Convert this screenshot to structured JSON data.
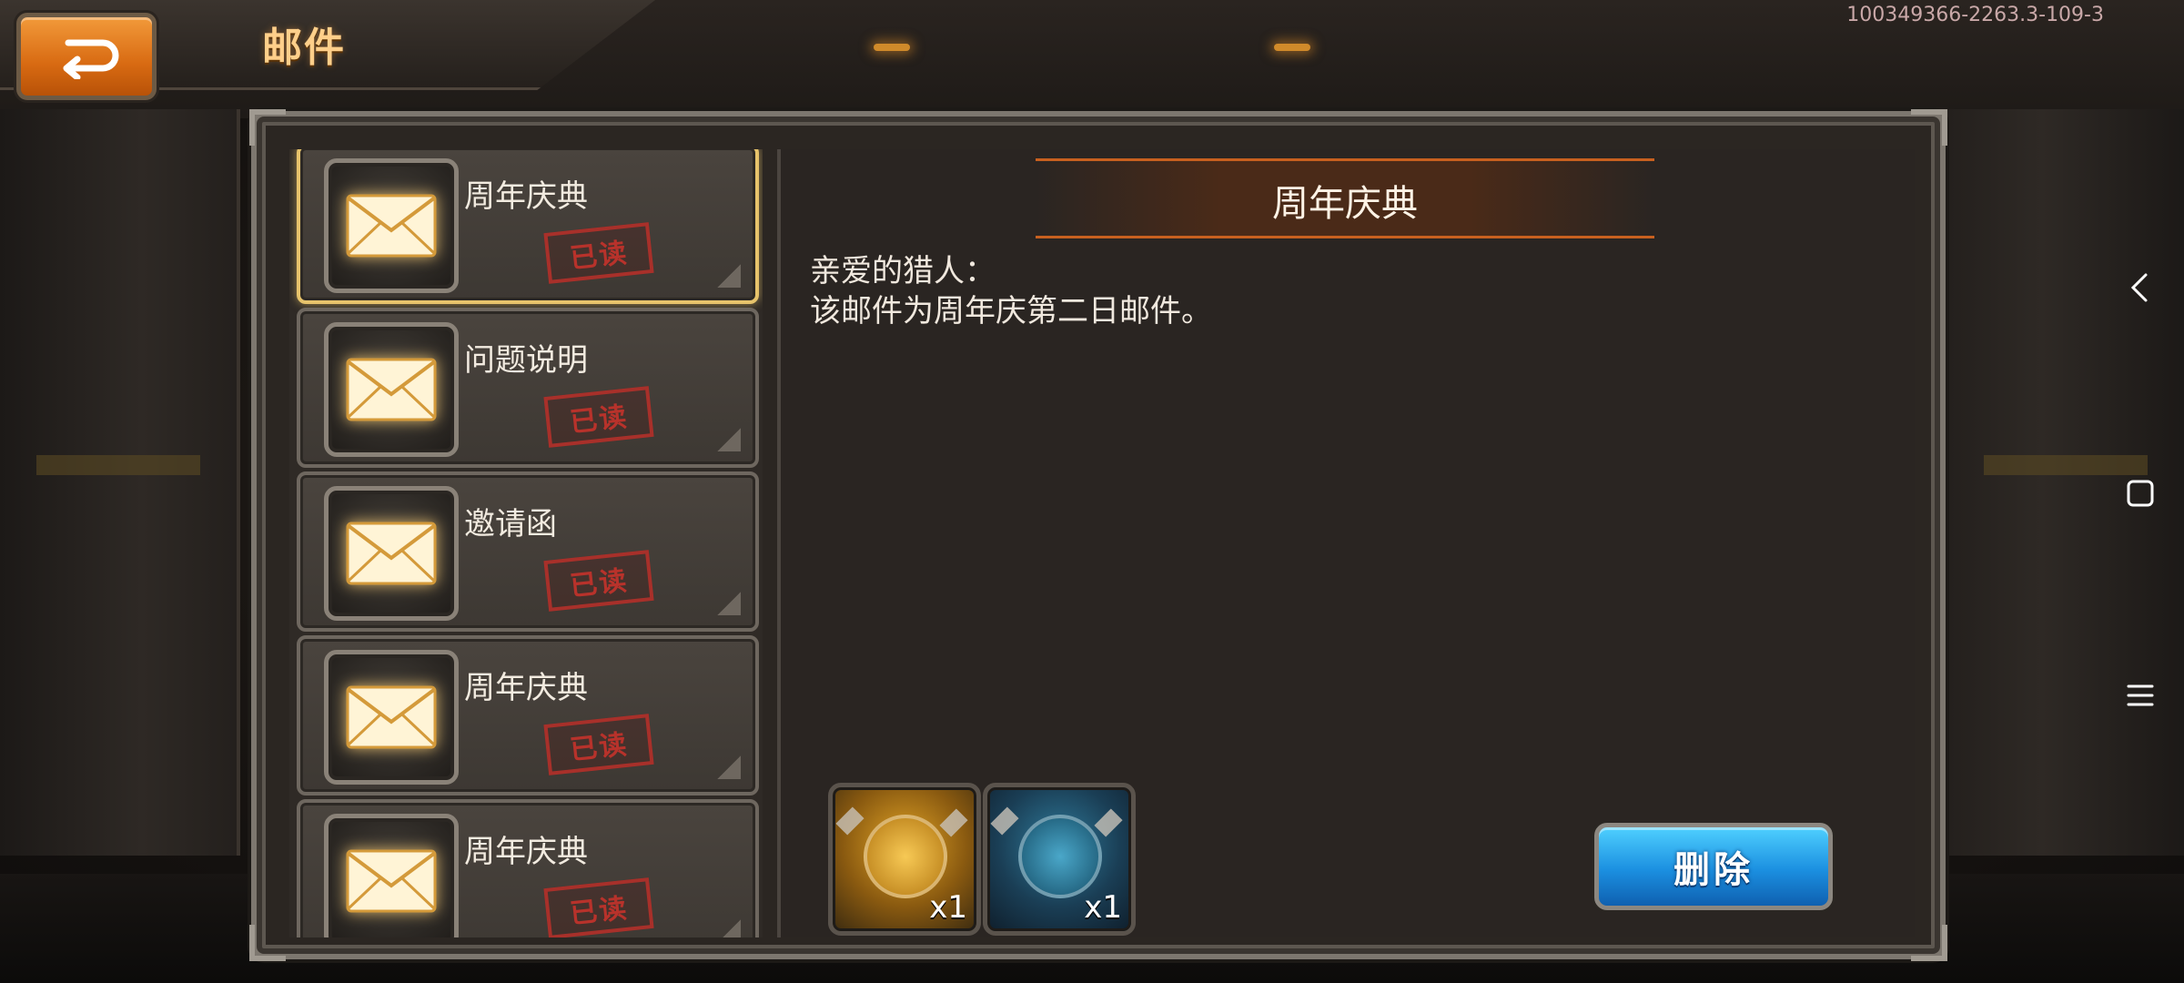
{
  "header": {
    "title": "邮件",
    "version": "100349366-2263.3-109-3"
  },
  "mail_list": [
    {
      "title": "周年庆典",
      "status": "已读",
      "selected": true
    },
    {
      "title": "问题说明",
      "status": "已读",
      "selected": false
    },
    {
      "title": "邀请函",
      "status": "已读",
      "selected": false
    },
    {
      "title": "周年庆典",
      "status": "已读",
      "selected": false
    },
    {
      "title": "周年庆典",
      "status": "已读",
      "selected": false
    }
  ],
  "detail": {
    "title": "周年庆典",
    "greeting": "亲爱的猎人：",
    "body": "该邮件为周年庆第二日邮件。",
    "rewards": [
      {
        "icon": "gold-medal-icon",
        "qty": "x1",
        "color": "#e0a326"
      },
      {
        "icon": "blue-medal-icon",
        "qty": "x1",
        "color": "#2f7a9a"
      }
    ],
    "delete_label": "删除"
  },
  "colors": {
    "accent_orange": "#d86a12",
    "title_gold": "#ffcf8a",
    "read_stamp_red": "#b8322b",
    "delete_blue": "#1b8fe0"
  }
}
